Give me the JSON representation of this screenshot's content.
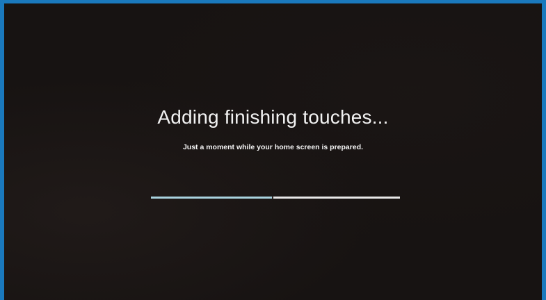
{
  "setup_screen": {
    "title": "Adding finishing touches...",
    "subtitle": "Just a moment while your home screen is prepared.",
    "progress_fraction": 0.485
  },
  "colors": {
    "bezel": "#1a79bd",
    "screen_background": "#171312",
    "progress_fill": "#a9d3df",
    "progress_track": "#e8e8e8",
    "text": "#f2f2f2"
  }
}
